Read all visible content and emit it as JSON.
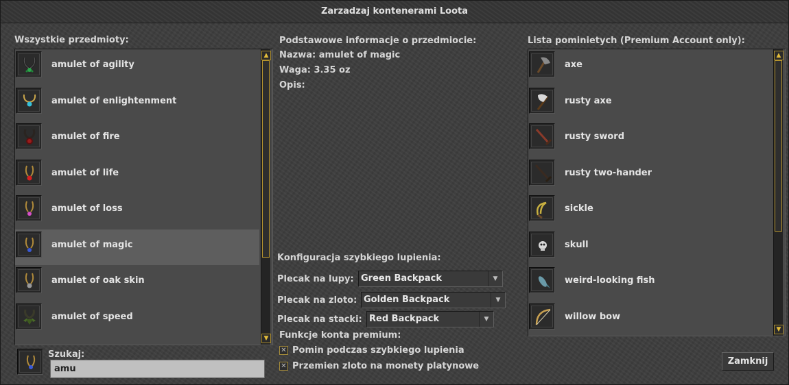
{
  "window": {
    "title": "Zarzadzaj kontenerami Loota"
  },
  "left": {
    "heading": "Wszystkie przedmioty:",
    "items": [
      {
        "label": "amulet of agility",
        "icon": "amulet-agility-icon"
      },
      {
        "label": "amulet of enlightenment",
        "icon": "amulet-enlightenment-icon"
      },
      {
        "label": "amulet of fire",
        "icon": "amulet-fire-icon"
      },
      {
        "label": "amulet of life",
        "icon": "amulet-life-icon"
      },
      {
        "label": "amulet of loss",
        "icon": "amulet-loss-icon"
      },
      {
        "label": "amulet of magic",
        "icon": "amulet-magic-icon",
        "selected": true
      },
      {
        "label": "amulet of oak skin",
        "icon": "amulet-oak-skin-icon"
      },
      {
        "label": "amulet of speed",
        "icon": "amulet-speed-icon"
      }
    ],
    "search_label": "Szukaj:",
    "search_value": "amu"
  },
  "middle": {
    "heading": "Podstawowe informacje o przedmiocie:",
    "name_line": "Nazwa: amulet of magic",
    "weight_line": "Waga: 3.35 oz",
    "desc_line": "Opis:",
    "quickloot_heading": "Konfiguracja szybkiego lupienia:",
    "loot_bp_label": "Plecak na lupy:",
    "loot_bp_value": "Green Backpack",
    "gold_bp_label": "Plecak na zloto:",
    "gold_bp_value": "Golden Backpack",
    "stack_bp_label": "Plecak na stacki:",
    "stack_bp_value": "Red Backpack",
    "premium_heading": "Funkcje konta premium:",
    "skip_checkbox": "Pomin podczas szybkiego lupienia",
    "convert_checkbox": "Przemien zloto na monety platynowe"
  },
  "right": {
    "heading": "Lista pominietych (Premium Account only):",
    "items": [
      {
        "label": "axe",
        "icon": "axe-icon"
      },
      {
        "label": "rusty axe",
        "icon": "rusty-axe-icon"
      },
      {
        "label": "rusty sword",
        "icon": "rusty-sword-icon"
      },
      {
        "label": "rusty two-hander",
        "icon": "rusty-two-hander-icon"
      },
      {
        "label": "sickle",
        "icon": "sickle-icon"
      },
      {
        "label": "skull",
        "icon": "skull-icon"
      },
      {
        "label": "weird-looking fish",
        "icon": "fish-icon"
      },
      {
        "label": "willow bow",
        "icon": "bow-icon"
      }
    ]
  },
  "footer": {
    "close_label": "Zamknij"
  },
  "colors": {
    "accent": "#b8962f",
    "text": "#e4e4e4",
    "selected_row": "#5e5e5e"
  }
}
